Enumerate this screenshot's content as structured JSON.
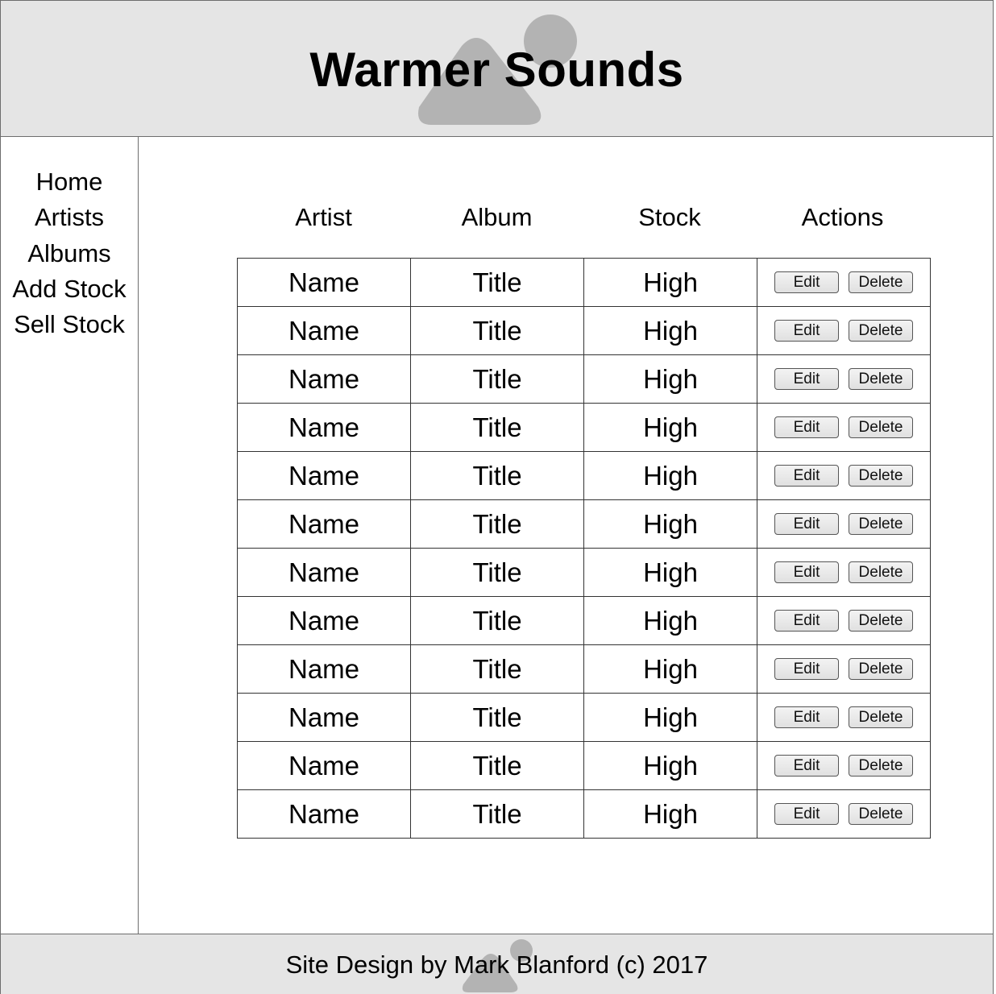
{
  "header": {
    "title": "Warmer Sounds",
    "placeholder_icon": "image-placeholder-icon"
  },
  "sidebar": {
    "items": [
      {
        "label": "Home"
      },
      {
        "label": "Artists"
      },
      {
        "label": "Albums"
      },
      {
        "label": "Add Stock"
      },
      {
        "label": "Sell Stock"
      }
    ]
  },
  "table": {
    "columns": [
      "Artist",
      "Album",
      "Stock",
      "Actions"
    ],
    "edit_label": "Edit",
    "delete_label": "Delete",
    "rows": [
      {
        "artist": "Name",
        "album": "Title",
        "stock": "High"
      },
      {
        "artist": "Name",
        "album": "Title",
        "stock": "High"
      },
      {
        "artist": "Name",
        "album": "Title",
        "stock": "High"
      },
      {
        "artist": "Name",
        "album": "Title",
        "stock": "High"
      },
      {
        "artist": "Name",
        "album": "Title",
        "stock": "High"
      },
      {
        "artist": "Name",
        "album": "Title",
        "stock": "High"
      },
      {
        "artist": "Name",
        "album": "Title",
        "stock": "High"
      },
      {
        "artist": "Name",
        "album": "Title",
        "stock": "High"
      },
      {
        "artist": "Name",
        "album": "Title",
        "stock": "High"
      },
      {
        "artist": "Name",
        "album": "Title",
        "stock": "High"
      },
      {
        "artist": "Name",
        "album": "Title",
        "stock": "High"
      },
      {
        "artist": "Name",
        "album": "Title",
        "stock": "High"
      }
    ]
  },
  "footer": {
    "credit": "Site Design by Mark Blanford (c) 2017"
  },
  "colors": {
    "header_bg": "#e5e5e5",
    "placeholder_gray": "#b3b3b3",
    "border": "#6d6d6d"
  }
}
